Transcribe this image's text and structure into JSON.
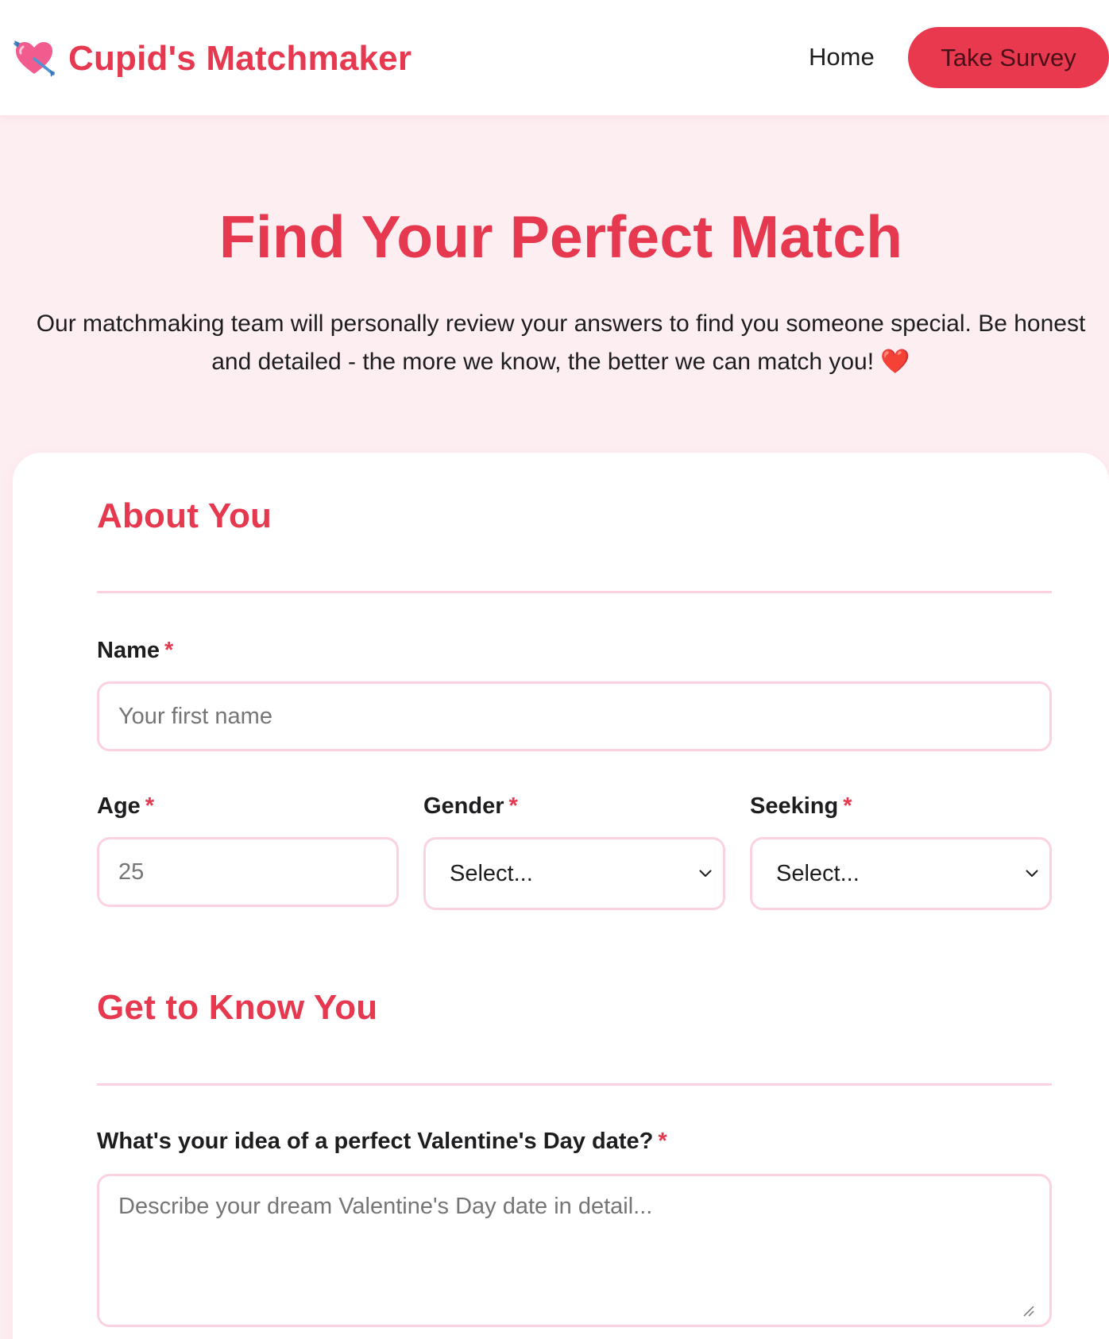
{
  "header": {
    "brand_icon": "heart-with-arrow-icon",
    "brand_name": "Cupid's Matchmaker",
    "nav_home": "Home",
    "nav_cta": "Take Survey"
  },
  "hero": {
    "title": "Find Your Perfect Match",
    "intro": "Our matchmaking team will personally review your answers to find you someone special. Be honest and detailed - the more we know, the better we can match you!",
    "heart": "❤️"
  },
  "form": {
    "required_marker": "*",
    "about_section": {
      "title": "About You",
      "name_label": "Name",
      "name_placeholder": "Your first name",
      "age_label": "Age",
      "age_placeholder": "25",
      "gender_label": "Gender",
      "gender_value": "Select...",
      "seeking_label": "Seeking",
      "seeking_value": "Select..."
    },
    "know_section": {
      "title": "Get to Know You",
      "date_label": "What's your idea of a perfect Valentine's Day date?",
      "date_placeholder": "Describe your dream Valentine's Day date in detail..."
    }
  },
  "colors": {
    "accent": "#e63950",
    "cta_background": "#e9394f",
    "page_background": "#fdeef2",
    "field_border": "#fbd2dd",
    "card_background": "#ffffff"
  }
}
